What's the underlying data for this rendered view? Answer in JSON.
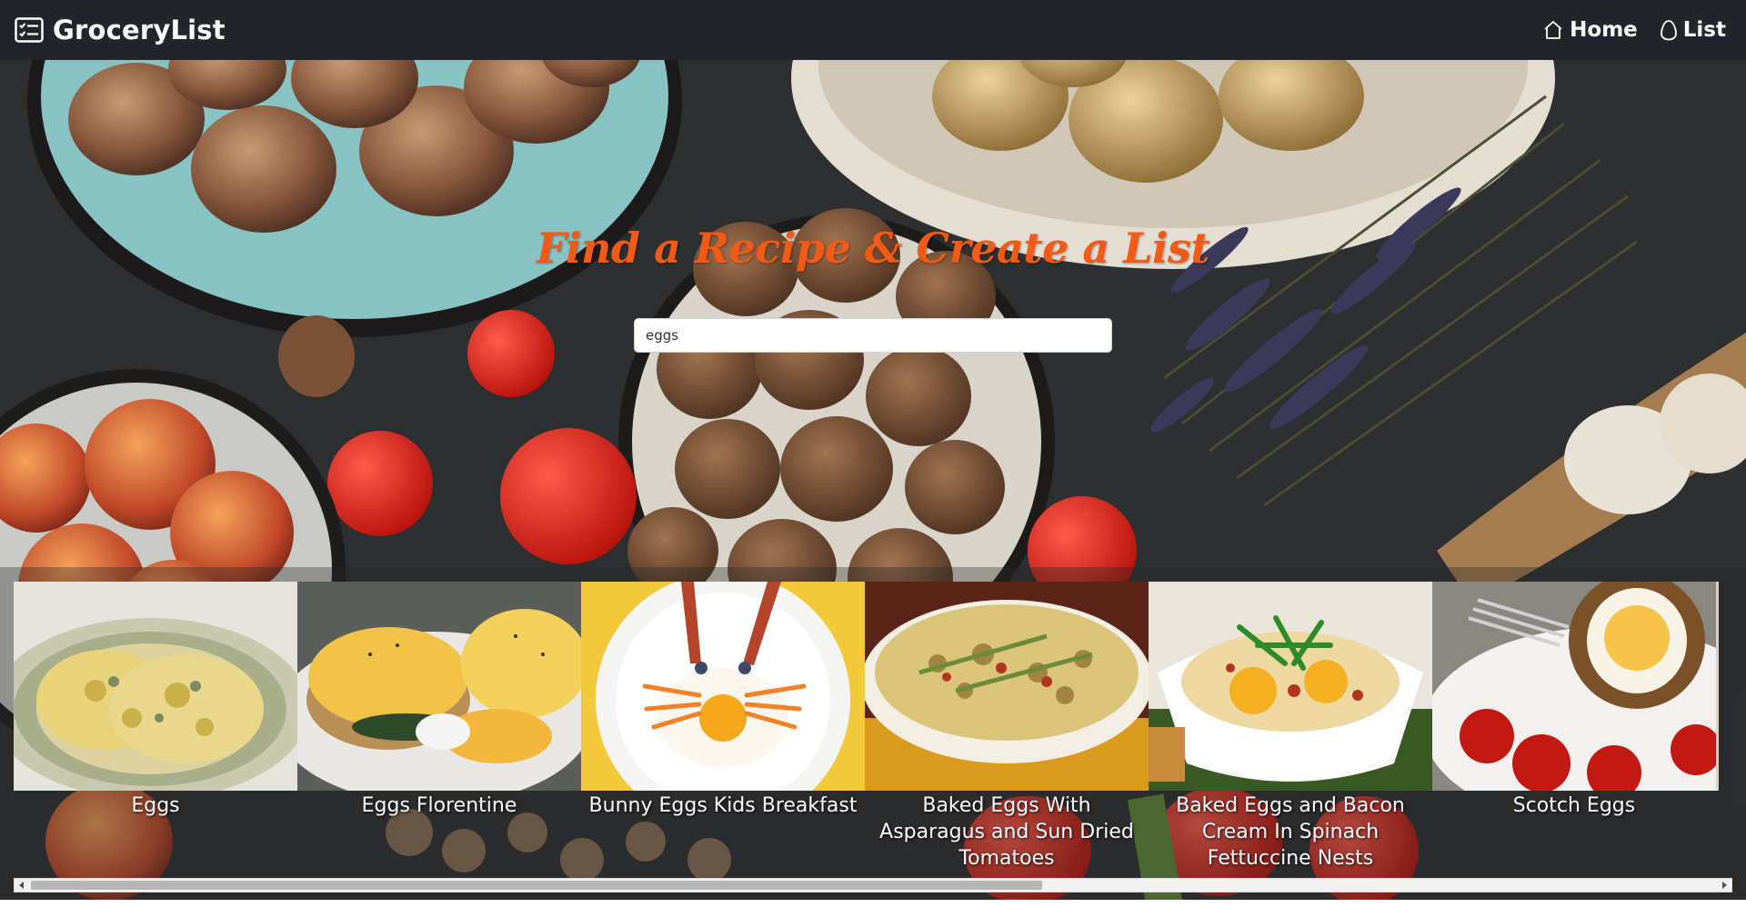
{
  "navbar": {
    "brand": "GroceryList",
    "brand_icon": "list-card-icon",
    "links": [
      {
        "label": "Home",
        "icon": "house-icon"
      },
      {
        "label": "List",
        "icon": "egg-icon"
      }
    ]
  },
  "hero": {
    "title": "Find a Recipe & Create a List",
    "title_color": "#f25a17"
  },
  "search": {
    "value": "eggs"
  },
  "recipes": [
    {
      "title": "Eggs"
    },
    {
      "title": "Eggs Florentine"
    },
    {
      "title": "Bunny Eggs Kids Breakfast"
    },
    {
      "title": "Baked Eggs With Asparagus and Sun Dried Tomatoes"
    },
    {
      "title": "Baked Eggs and Bacon Cream In Spinach Fettuccine Nests"
    },
    {
      "title": "Scotch Eggs"
    }
  ],
  "scrollbar": {
    "position_fraction": 0.0,
    "visible_fraction": 0.6
  },
  "colors": {
    "navbar_bg": "#22262b",
    "accent": "#f25a17"
  }
}
